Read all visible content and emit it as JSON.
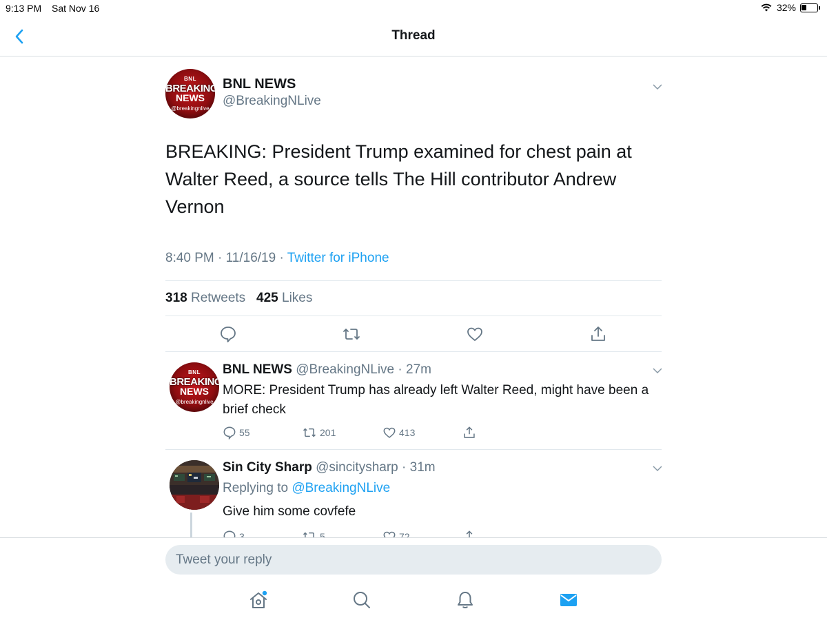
{
  "status": {
    "time": "9:13 PM",
    "date": "Sat Nov 16",
    "battery": "32%",
    "battery_level": 0.32
  },
  "nav": {
    "title": "Thread"
  },
  "tweet": {
    "avatar": {
      "line1": "BNL",
      "line2": "BREAKING",
      "line3": "NEWS",
      "line4": "@breakingnlive"
    },
    "name": "BNL NEWS",
    "handle": "@BreakingNLive",
    "text": "BREAKING: President Trump examined for chest pain at Walter Reed, a source tells The Hill contributor Andrew Vernon",
    "time": "8:40 PM · 11/16/19 · ",
    "source": "Twitter for iPhone",
    "retweets_count": "318",
    "retweets_label": " Retweets",
    "likes_count": "425",
    "likes_label": " Likes"
  },
  "replies": [
    {
      "name": "BNL NEWS",
      "meta": " @BreakingNLive · 27m",
      "text": "MORE: President Trump has already left Walter Reed, might have been a brief check",
      "replies": "55",
      "retweets": "201",
      "likes": "413"
    },
    {
      "name": "Sin City Sharp",
      "meta": " @sincitysharp · 31m",
      "replying_label": "Replying to ",
      "replying_to": "@BreakingNLive",
      "text": "Give him some covfefe",
      "replies": "3",
      "retweets": "5",
      "likes": "72"
    }
  ],
  "reply_bar": {
    "placeholder": "Tweet your reply"
  },
  "tabs": [
    "home-icon",
    "search-icon",
    "notifications-icon",
    "messages-icon"
  ],
  "colors": {
    "accent": "#1da1f2",
    "muted": "#657786",
    "text": "#14171a"
  }
}
